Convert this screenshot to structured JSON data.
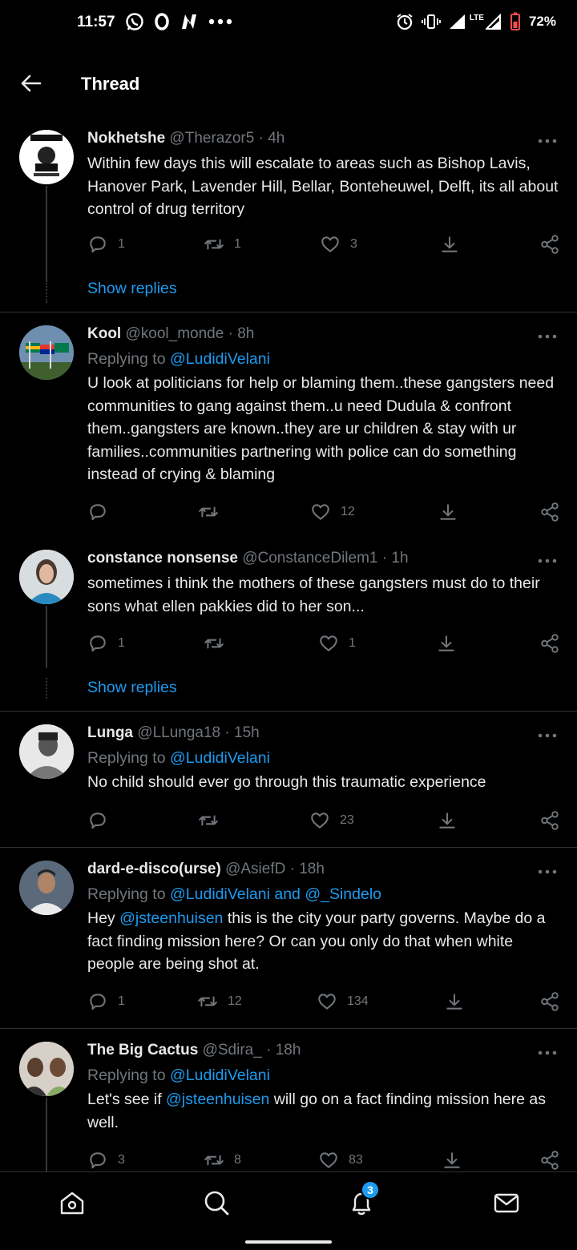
{
  "status": {
    "time": "11:57",
    "battery": "72%",
    "network": "LTE"
  },
  "topbar": {
    "title": "Thread"
  },
  "tweets": [
    {
      "name": "Nokhetshe",
      "handle": "@Therazor5",
      "time": "4h",
      "replying_prefix": "",
      "replying_to": "",
      "text": "Within few days this will escalate to areas such as  Bishop Lavis, Hanover Park, Lavender Hill, Bellar, Bonteheuwel, Delft, its all about control of drug territory",
      "replies": "1",
      "retweets": "1",
      "likes": "3",
      "show_replies": "Show replies"
    },
    {
      "name": "Kool",
      "handle": "@kool_monde",
      "time": "8h",
      "replying_prefix": "Replying to ",
      "replying_to": "@LudidiVelani",
      "text": "U look at politicians for help or blaming them..these gangsters need communities to gang against them..u need Dudula & confront them..gangsters are known..they are ur children & stay with ur families..communities partnering with police can do something instead of crying & blaming",
      "replies": "",
      "retweets": "",
      "likes": "12"
    },
    {
      "name": "constance nonsense",
      "handle": "@ConstanceDilem1",
      "time": "1h",
      "replying_prefix": "",
      "replying_to": "",
      "text": "sometimes i think the mothers of these gangsters must do to their sons what ellen pakkies did to her son...",
      "replies": "1",
      "retweets": "",
      "likes": "1",
      "show_replies": "Show replies"
    },
    {
      "name": "Lunga",
      "handle": "@LLunga18",
      "time": "15h",
      "replying_prefix": "Replying to ",
      "replying_to": "@LudidiVelani",
      "text": "No child should ever go through this traumatic experience",
      "replies": "",
      "retweets": "",
      "likes": "23"
    },
    {
      "name": "dard-e-disco(urse)",
      "handle": "@AsiefD",
      "time": "18h",
      "replying_prefix": "Replying to ",
      "replying_to": "@LudidiVelani and @_Sindelo",
      "text_before": "Hey ",
      "mention": "@jsteenhuisen",
      "text_after": " this is the city your party governs. Maybe do a fact finding mission here? Or can you only do that when white people are being shot at.",
      "replies": "1",
      "retweets": "12",
      "likes": "134"
    },
    {
      "name": "The Big Cactus",
      "handle": "@Sdira_",
      "time": "18h",
      "replying_prefix": "Replying to ",
      "replying_to": "@LudidiVelani",
      "text_before": "Let's see if ",
      "mention": "@jsteenhuisen",
      "text_after": " will go on a fact finding mission here as well.",
      "replies": "3",
      "retweets": "8",
      "likes": "83"
    }
  ],
  "nav": {
    "badge": "3",
    "items": [
      "home-icon",
      "search-icon",
      "notifications-icon",
      "messages-icon"
    ]
  },
  "colors": {
    "accent": "#1d9bf0",
    "muted": "#71767b",
    "text": "#e7e9ea",
    "background": "#000000"
  }
}
